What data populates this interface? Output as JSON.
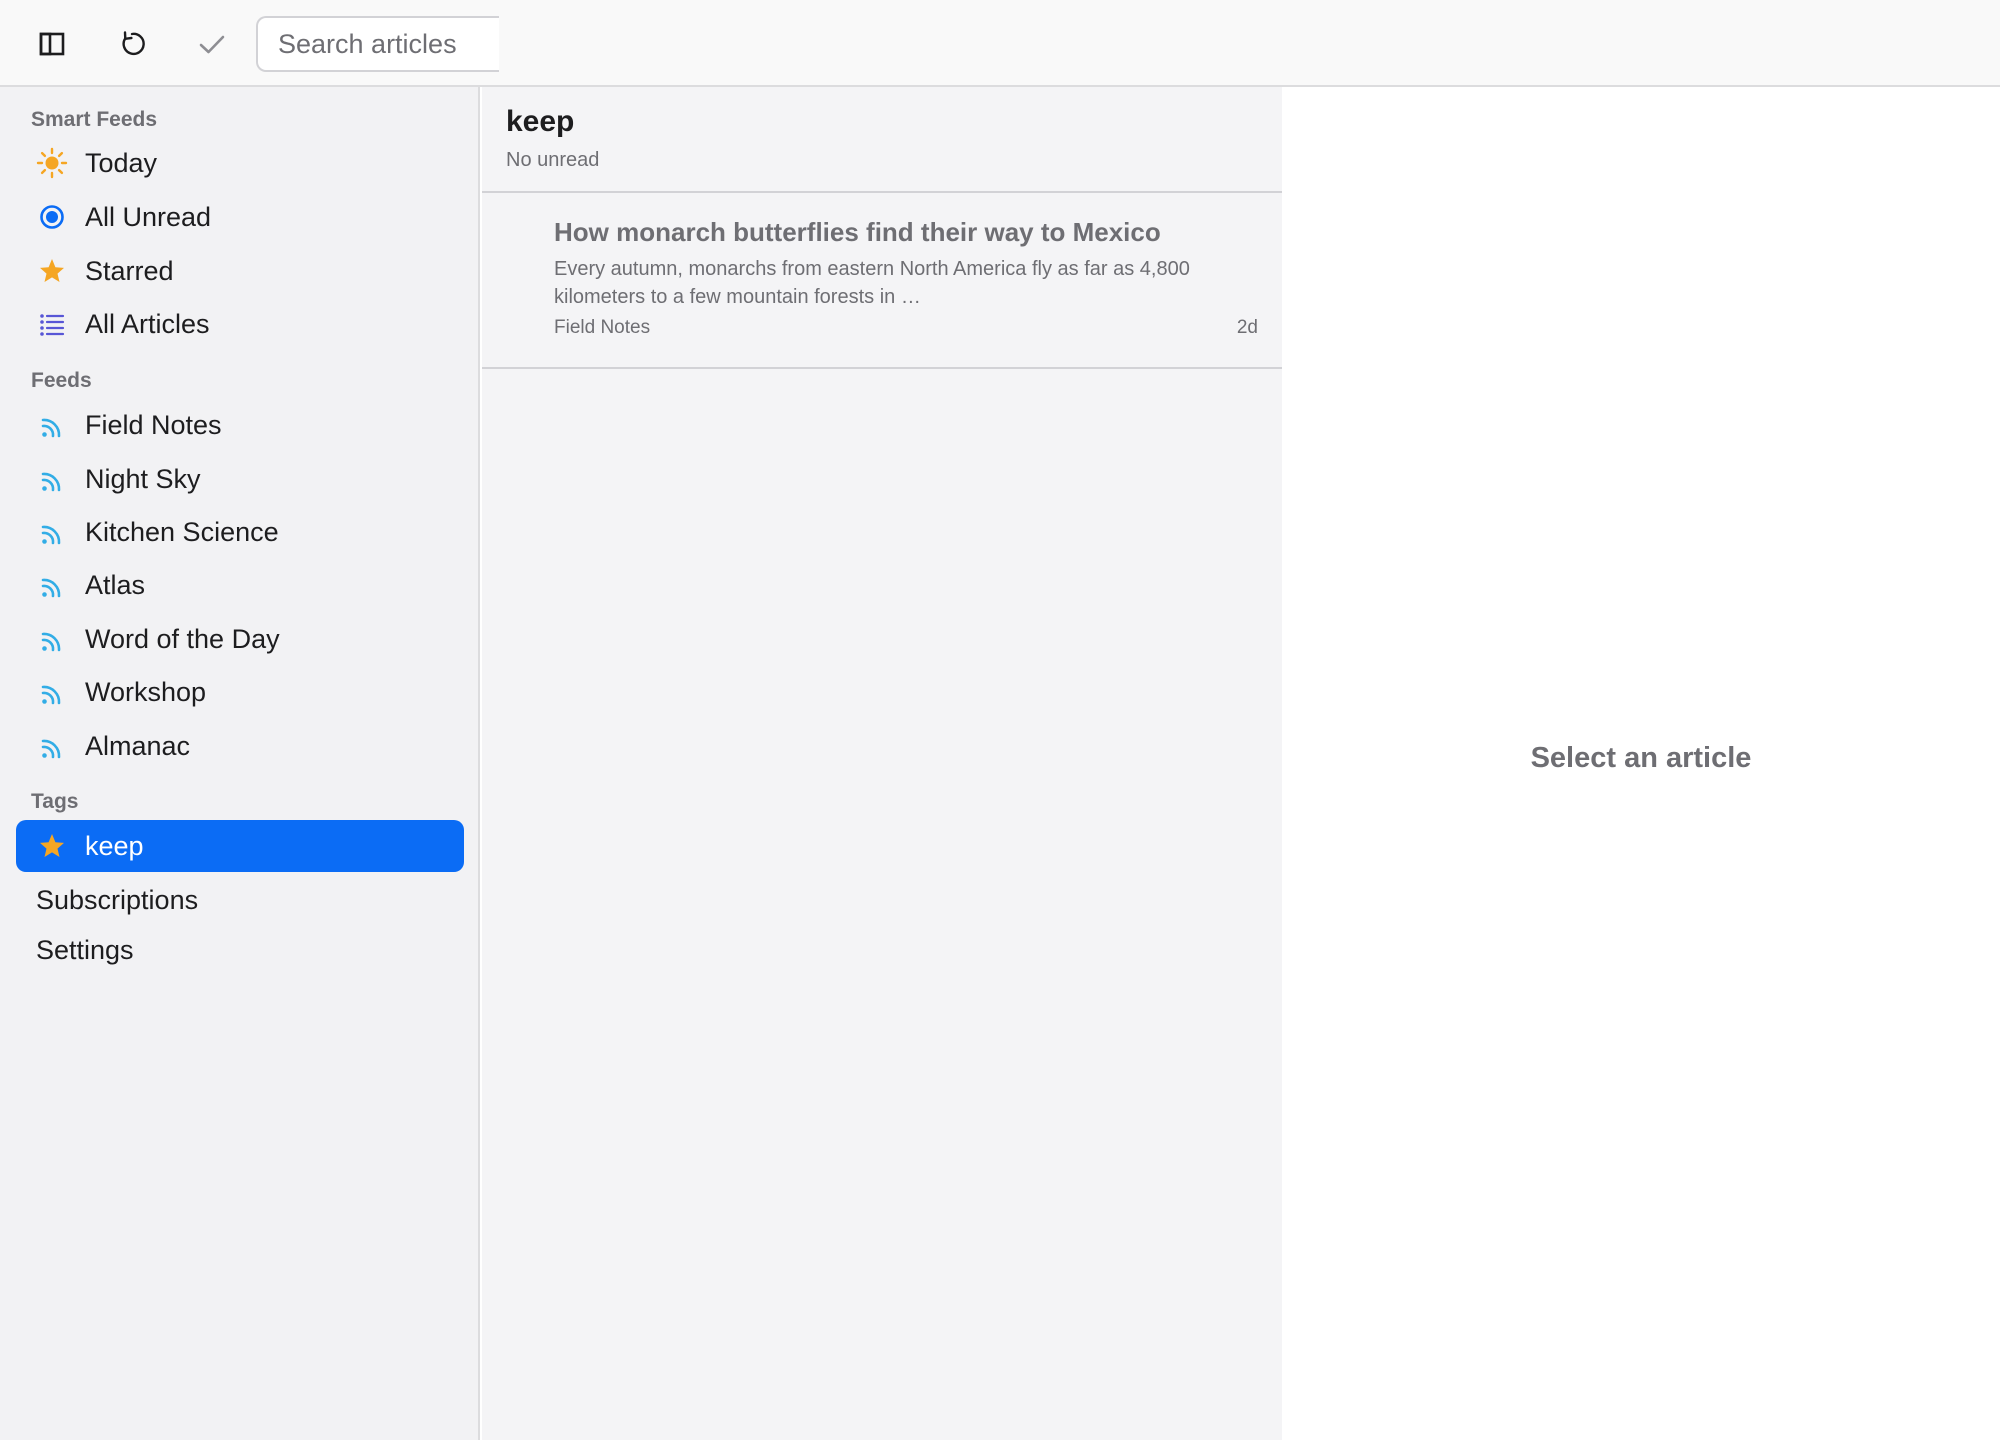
{
  "toolbar": {
    "sidebar_toggle_icon": "sidebar-icon",
    "refresh_icon": "refresh-icon",
    "mark_read_icon": "checkmark-icon",
    "search_placeholder": "Search articles",
    "search_value": ""
  },
  "sidebar": {
    "smart_feeds_title": "Smart Feeds",
    "smart_feeds": [
      {
        "label": "Today",
        "icon": "sun-icon",
        "color": "#f5a623"
      },
      {
        "label": "All Unread",
        "icon": "unread-circle-icon",
        "color": "#0b6cf5"
      },
      {
        "label": "Starred",
        "icon": "star-icon",
        "color": "#f5a623"
      },
      {
        "label": "All Articles",
        "icon": "list-icon",
        "color": "#5856d6"
      }
    ],
    "feeds_title": "Feeds",
    "feeds": [
      {
        "label": "Field Notes",
        "icon": "rss-icon"
      },
      {
        "label": "Night Sky",
        "icon": "rss-icon"
      },
      {
        "label": "Kitchen Science",
        "icon": "rss-icon"
      },
      {
        "label": "Atlas",
        "icon": "rss-icon"
      },
      {
        "label": "Word of the Day",
        "icon": "rss-icon"
      },
      {
        "label": "Workshop",
        "icon": "rss-icon"
      },
      {
        "label": "Almanac",
        "icon": "rss-icon"
      }
    ],
    "feed_icon_color": "#32ade6",
    "tags_title": "Tags",
    "tags": [
      {
        "label": "keep",
        "icon": "star-icon",
        "selected": true
      }
    ],
    "subscriptions_label": "Subscriptions",
    "settings_label": "Settings",
    "selection_color": "#0b6cf5"
  },
  "list": {
    "title": "keep",
    "subtitle": "No unread",
    "articles": [
      {
        "title": "How monarch butterflies find their way to Mexico",
        "snippet": "Every autumn, monarchs from eastern North America fly as far as 4,800 kilometers to a few mountain forests in …",
        "feed": "Field Notes",
        "age": "2d"
      }
    ]
  },
  "reader": {
    "empty_text": "Select an article"
  }
}
